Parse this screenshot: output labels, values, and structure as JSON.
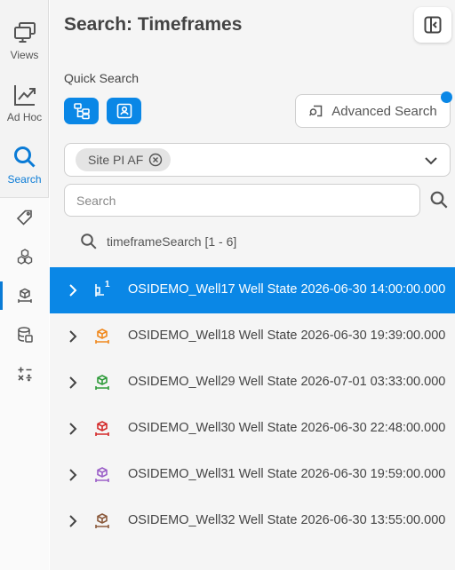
{
  "rail": {
    "items": [
      {
        "label": "Views",
        "icon": "monitor-stack-icon"
      },
      {
        "label": "Ad Hoc",
        "icon": "trend-chart-icon"
      },
      {
        "label": "Search",
        "icon": "search-icon",
        "active": true
      }
    ],
    "sub_items": [
      {
        "icon": "tag-icon"
      },
      {
        "icon": "cubes-icon"
      },
      {
        "icon": "timeframe-icon",
        "active": true
      },
      {
        "icon": "database-icon"
      },
      {
        "icon": "calculation-icon"
      }
    ]
  },
  "header": {
    "title": "Search: Timeframes",
    "collapse_icon": "panel-collapse-icon"
  },
  "quick_search": {
    "label": "Quick Search",
    "buttons": [
      "hierarchy-icon",
      "contact-card-icon"
    ],
    "advanced_label": "Advanced Search"
  },
  "source": {
    "chip": "Site PI AF"
  },
  "search": {
    "placeholder": "Search",
    "value": ""
  },
  "results": {
    "header": "timeframeSearch [1 - 6]",
    "rows": [
      {
        "text": "OSIDEMO_Well17 Well State 2026-06-30 14:00:00.000",
        "color": "#ffffff",
        "badge": "1",
        "selected": true
      },
      {
        "text": "OSIDEMO_Well18 Well State 2026-06-30 19:39:00.000",
        "color": "#f0891e"
      },
      {
        "text": "OSIDEMO_Well29 Well State 2026-07-01 03:33:00.000",
        "color": "#2e9b3a"
      },
      {
        "text": "OSIDEMO_Well30 Well State 2026-06-30 22:48:00.000",
        "color": "#d42a2a"
      },
      {
        "text": "OSIDEMO_Well31 Well State 2026-06-30 19:59:00.000",
        "color": "#9b5fc8"
      },
      {
        "text": "OSIDEMO_Well32 Well State 2026-06-30 13:55:00.000",
        "color": "#8b5a3c"
      }
    ]
  },
  "colors": {
    "accent": "#0a87e6",
    "rail_active": "#0a7bd6"
  }
}
